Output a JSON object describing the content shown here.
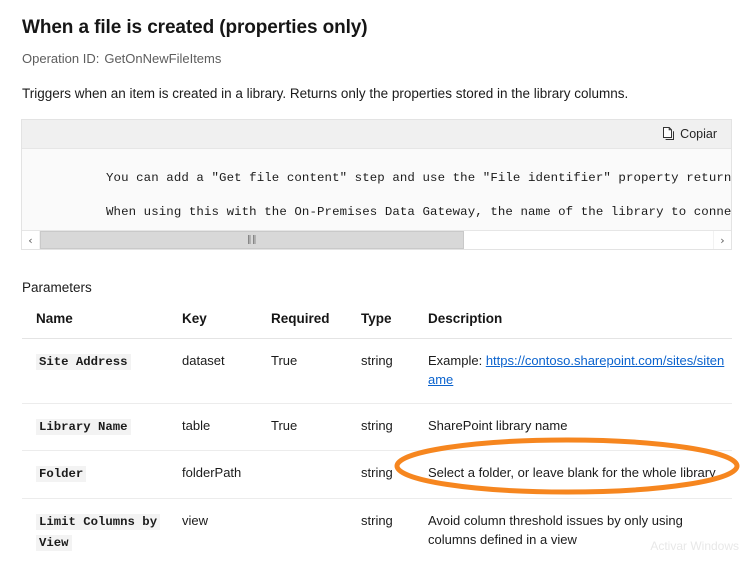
{
  "header": {
    "title": "When a file is created (properties only)",
    "operation_id_label": "Operation ID:",
    "operation_id_value": "GetOnNewFileItems",
    "description": "Triggers when an item is created in a library. Returns only the properties stored in the library columns."
  },
  "codeblock": {
    "copy_label": "Copiar",
    "copy_icon": "copy-icon",
    "lines": [
      "You can add a \"Get file content\" step and use the \"File identifier\" property returned by th",
      "When using this with the On-Premises Data Gateway, the name of the library to connect to ma"
    ],
    "scrollbar": {
      "left_arrow": "‹",
      "right_arrow": "›",
      "grip": "‖‖",
      "thumb_width_pct": 63
    }
  },
  "parameters": {
    "section_title": "Parameters",
    "columns": [
      "Name",
      "Key",
      "Required",
      "Type",
      "Description"
    ],
    "rows": [
      {
        "name": "Site Address",
        "key": "dataset",
        "required": "True",
        "type": "string",
        "description_prefix": "Example: ",
        "link_text": "https://contoso.sharepoint.com/sites/sitename",
        "description": ""
      },
      {
        "name": "Library Name",
        "key": "table",
        "required": "True",
        "type": "string",
        "description": "SharePoint library name"
      },
      {
        "name": "Folder",
        "key": "folderPath",
        "required": "",
        "type": "string",
        "description": "Select a folder, or leave blank for the whole library"
      },
      {
        "name": "Limit Columns by View",
        "key": "view",
        "required": "",
        "type": "string",
        "description": "Avoid column threshold issues by only using columns defined in a view"
      }
    ]
  },
  "annotation": {
    "type": "ellipse",
    "target": "folder-row-description",
    "color": "#F6861F",
    "stroke_width": 5
  },
  "watermark": {
    "text": "Activar Windows"
  },
  "colors": {
    "link": "#0b63ce",
    "code_bg": "#f3f3f3",
    "toolbar_bg": "#f0f0f0",
    "highlight": "#F6861F"
  }
}
